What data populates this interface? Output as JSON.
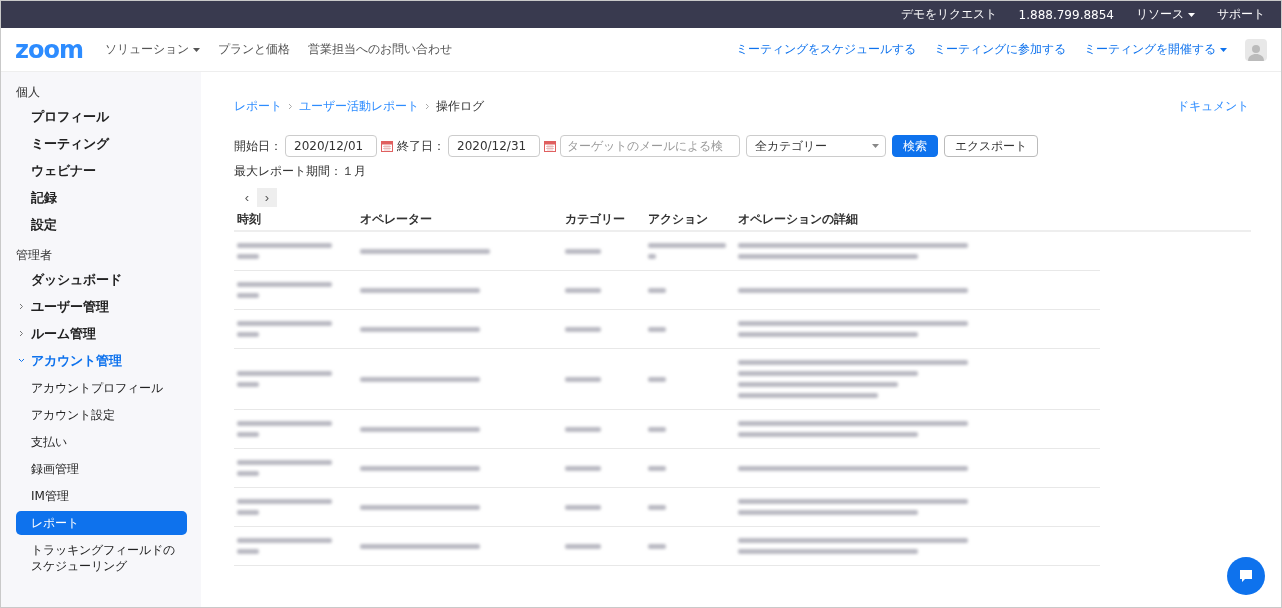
{
  "top_bar": {
    "links": [
      {
        "label": "デモをリクエスト",
        "kind": "link"
      },
      {
        "label": "1.888.799.8854",
        "kind": "link"
      },
      {
        "label": "リソース",
        "kind": "dropdown"
      },
      {
        "label": "サポート",
        "kind": "link"
      }
    ]
  },
  "nav": {
    "logo": "zoom",
    "left_links": [
      {
        "label": "ソリューション",
        "kind": "dropdown"
      },
      {
        "label": "プランと価格",
        "kind": "link"
      },
      {
        "label": "営業担当へのお問い合わせ",
        "kind": "link"
      }
    ],
    "right_links": [
      {
        "label": "ミーティングをスケジュールする",
        "kind": "link"
      },
      {
        "label": "ミーティングに参加する",
        "kind": "link"
      },
      {
        "label": "ミーティングを開催する",
        "kind": "dropdown"
      }
    ]
  },
  "sidebar": {
    "sections": [
      {
        "heading": "個人",
        "items": [
          {
            "label": "プロフィール",
            "selected": false
          },
          {
            "label": "ミーティング",
            "selected": false
          },
          {
            "label": "ウェビナー",
            "selected": false
          },
          {
            "label": "記録",
            "selected": false
          },
          {
            "label": "設定",
            "selected": false
          }
        ]
      },
      {
        "heading": "管理者",
        "items": [
          {
            "label": "ダッシュボード",
            "selected": false
          },
          {
            "label": "ユーザー管理",
            "selected": false,
            "expanded": false
          },
          {
            "label": "ルーム管理",
            "selected": false,
            "expanded": false
          },
          {
            "label": "アカウント管理",
            "selected": false,
            "expanded": true,
            "children": [
              {
                "label": "アカウントプロフィール",
                "selected": false
              },
              {
                "label": "アカウント設定",
                "selected": false
              },
              {
                "label": "支払い",
                "selected": false
              },
              {
                "label": "録画管理",
                "selected": false
              },
              {
                "label": "IM管理",
                "selected": false
              },
              {
                "label": "レポート",
                "selected": true
              },
              {
                "label": "トラッキングフィールドのスケジューリング",
                "selected": false
              }
            ]
          }
        ]
      }
    ]
  },
  "breadcrumb": [
    {
      "label": "レポート",
      "kind": "link"
    },
    {
      "label": "ユーザー活動レポート",
      "kind": "link"
    },
    {
      "label": "操作ログ",
      "kind": "current"
    }
  ],
  "doc_link": "ドキュメント",
  "filters": {
    "start_label": "開始日：",
    "start_value": "2020/12/01",
    "end_label": "終了日：",
    "end_value": "2020/12/31",
    "target": {
      "placeholder": "ターゲットのメールによる検"
    },
    "category": "全カテゴリー",
    "search_button": "検索",
    "export_button": "エクスポート"
  },
  "max_period": "最大レポート期間：１月",
  "pager": {
    "prev": "‹",
    "next": "›"
  },
  "table": {
    "columns": [
      "時刻",
      "オペレーター",
      "カテゴリー",
      "アクション",
      "オペレーションの詳細"
    ]
  }
}
